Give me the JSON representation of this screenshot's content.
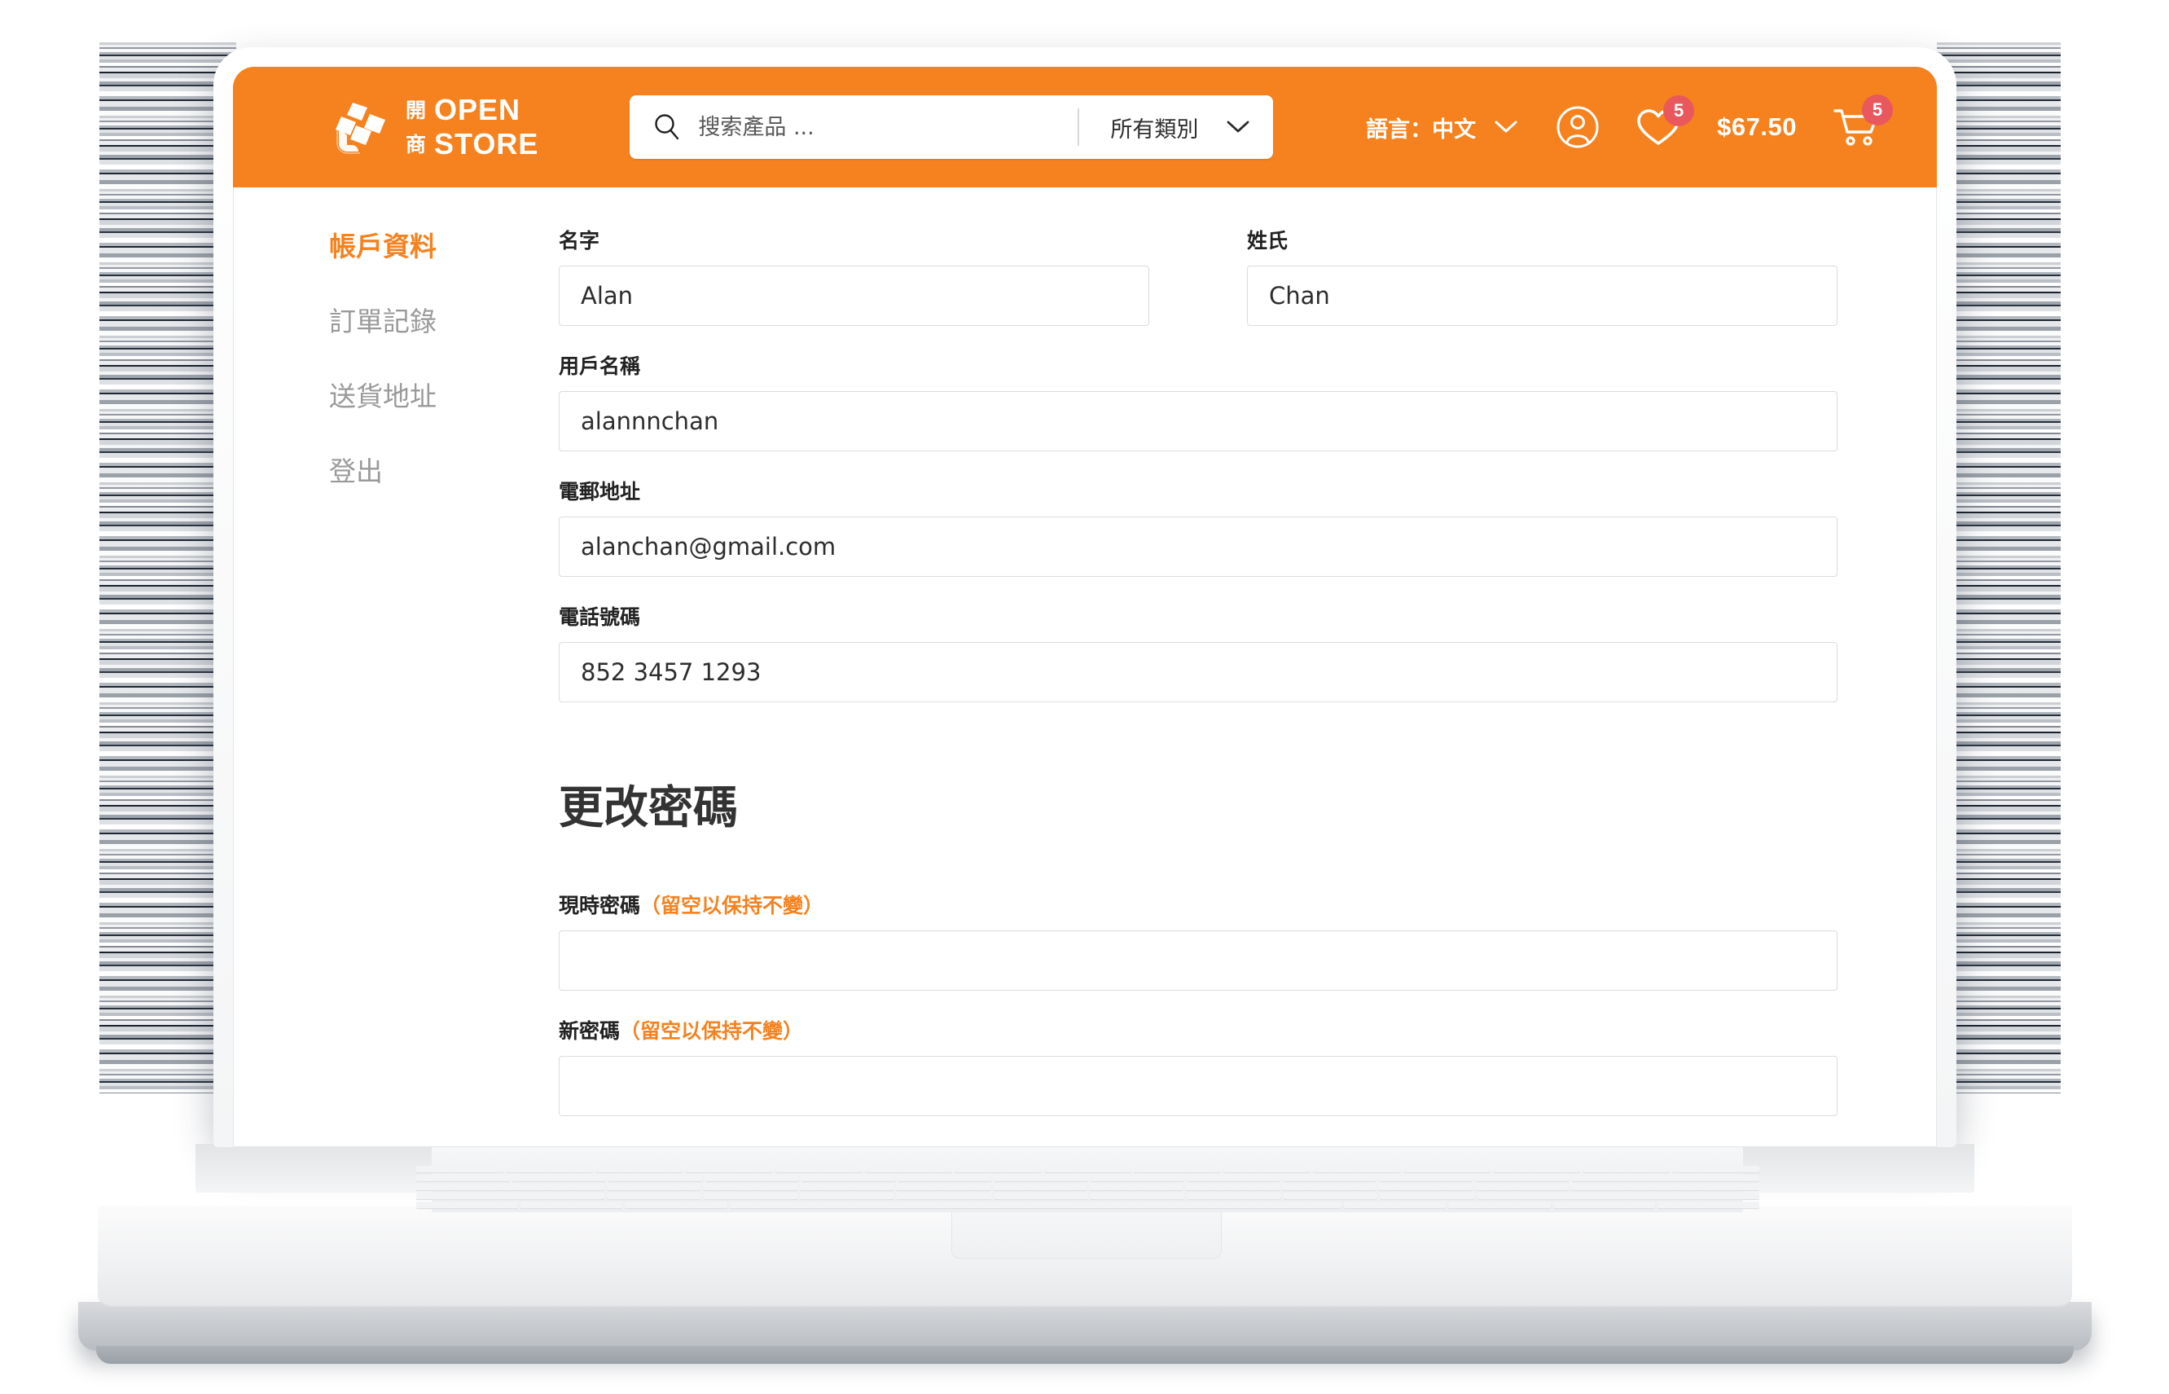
{
  "brand": {
    "cn_line1": "開",
    "cn_line2": "商",
    "en_line1": "OPEN",
    "en_line2": "STORE",
    "accent_color": "#F5821F",
    "badge_color": "#E8585C"
  },
  "header": {
    "search": {
      "placeholder": "搜索產品 ...",
      "value": "",
      "icon": "search-icon"
    },
    "category": {
      "selected": "所有類別",
      "chevron": "chevron-down-icon"
    },
    "language": {
      "label": "語言：中文",
      "chevron": "chevron-down-icon"
    },
    "account_icon": "user-circle-icon",
    "wishlist": {
      "icon": "heart-icon",
      "count": "5"
    },
    "cart": {
      "icon": "cart-icon",
      "count": "5",
      "total": "$67.50"
    }
  },
  "sidebar": {
    "items": [
      {
        "label": "帳戶資料",
        "active": true
      },
      {
        "label": "訂單記錄",
        "active": false
      },
      {
        "label": "送貨地址",
        "active": false
      },
      {
        "label": "登出",
        "active": false
      }
    ]
  },
  "account_form": {
    "first_name": {
      "label": "名字",
      "value": "Alan"
    },
    "last_name": {
      "label": "姓氏",
      "value": "Chan"
    },
    "username": {
      "label": "用戶名稱",
      "value": "alannnchan"
    },
    "email": {
      "label": "電郵地址",
      "value": "alanchan@gmail.com"
    },
    "phone": {
      "label": "電話號碼",
      "value": "852 3457 1293"
    }
  },
  "password_section": {
    "title": "更改密碼",
    "current": {
      "label": "現時密碼",
      "hint": "（留空以保持不變）",
      "value": ""
    },
    "new": {
      "label": "新密碼",
      "hint": "（留空以保持不變）",
      "value": ""
    }
  }
}
